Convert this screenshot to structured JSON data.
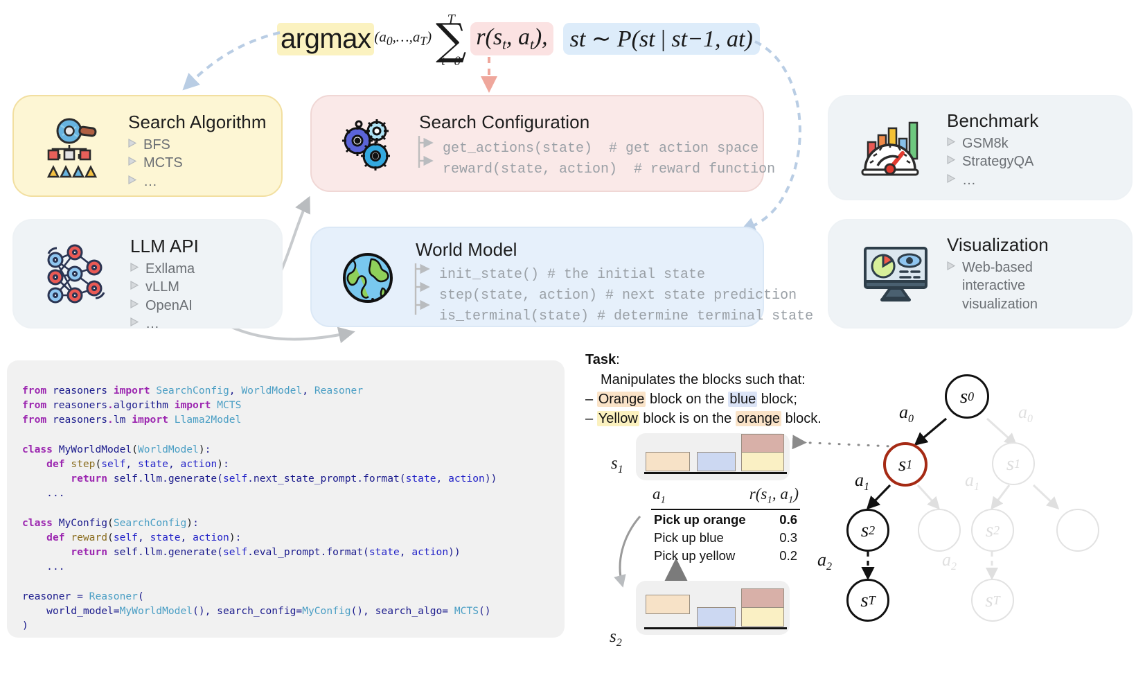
{
  "equation": {
    "argmax": "argmax",
    "argmax_sub": "(a₀,…,a_T)",
    "sigma_top": "T",
    "sigma_bottom": "t=0",
    "reward_term": "r(s_t, a_t),",
    "transition_term": "s_t ~ P(s_t | s_{t-1}, a_t)"
  },
  "modules": {
    "search_algorithm": {
      "title": "Search Algorithm",
      "icon": "magnifier-tree-icon",
      "items": [
        "BFS",
        "MCTS",
        "…"
      ]
    },
    "search_configuration": {
      "title": "Search Configuration",
      "icon": "gears-icon",
      "methods": [
        "get_actions(state)  # get action space",
        "reward(state, action)  # reward function"
      ]
    },
    "benchmark": {
      "title": "Benchmark",
      "icon": "gauge-chart-icon",
      "items": [
        "GSM8k",
        "StrategyQA",
        "…"
      ]
    },
    "llm_api": {
      "title": "LLM API",
      "icon": "neural-network-icon",
      "items": [
        "Exllama",
        "vLLM",
        "OpenAI",
        "…"
      ]
    },
    "world_model": {
      "title": "World Model",
      "icon": "globe-icon",
      "methods": [
        "init_state() # the initial state",
        "step(state, action) # next state prediction",
        "is_terminal(state) # determine terminal state"
      ]
    },
    "visualization": {
      "title": "Visualization",
      "icon": "monitor-chart-icon",
      "items": [
        "Web-based interactive visualization"
      ]
    }
  },
  "code": {
    "lines": [
      "from reasoners import SearchConfig, WorldModel, Reasoner",
      "from reasoners.algorithm import MCTS",
      "from reasoners.lm import Llama2Model",
      "",
      "class MyWorldModel(WorldModel):",
      "    def step(self, state, action):",
      "        return self.llm.generate(self.next_state_prompt.format(state, action))",
      "    ...",
      "",
      "class MyConfig(SearchConfig):",
      "    def reward(self, state, action):",
      "        return self.llm.generate(self.eval_prompt.format(state, action))",
      "    ...",
      "",
      "reasoner = Reasoner(",
      "    world_model=MyWorldModel(), search_config=MyConfig(), search_algo= MCTS()",
      ")"
    ]
  },
  "task": {
    "heading": "Task",
    "heading_colon": ":",
    "line1": "Manipulates the blocks such that:",
    "bullet1_dash": "–",
    "bullet1_a": "Orange",
    "bullet1_b": " block on the ",
    "bullet1_c": "blue",
    "bullet1_d": " block;",
    "bullet2_dash": "–",
    "bullet2_a": "Yellow",
    "bullet2_b": " block is on the ",
    "bullet2_c": "orange",
    "bullet2_d": " block."
  },
  "states": {
    "s1_label": "s",
    "s1_sub": "1",
    "s2_label": "s",
    "s2_sub": "2"
  },
  "reward_table": {
    "col_action": "a",
    "col_action_sub": "1",
    "col_reward": "r(s",
    "col_reward_sub1": "1",
    "col_reward_mid": ", a",
    "col_reward_sub2": "1",
    "col_reward_end": ")",
    "rows": [
      {
        "action": "Pick up orange",
        "reward": "0.6",
        "selected": true
      },
      {
        "action": "Pick up blue",
        "reward": "0.3",
        "selected": false
      },
      {
        "action": "Pick up yellow",
        "reward": "0.2",
        "selected": false
      }
    ]
  },
  "tree": {
    "nodes": [
      {
        "id": "s0",
        "label": "s",
        "sub": "0",
        "style": "black"
      },
      {
        "id": "s1",
        "label": "s",
        "sub": "1",
        "style": "red"
      },
      {
        "id": "s2",
        "label": "s",
        "sub": "2",
        "style": "black"
      },
      {
        "id": "sT",
        "label": "s",
        "sub": "T",
        "style": "black"
      },
      {
        "id": "g_s1",
        "label": "s",
        "sub": "1",
        "style": "ghost"
      },
      {
        "id": "g_empty1",
        "label": "",
        "sub": "",
        "style": "ghost"
      },
      {
        "id": "g_s2",
        "label": "s",
        "sub": "2",
        "style": "ghost"
      },
      {
        "id": "g_empty2",
        "label": "",
        "sub": "",
        "style": "ghost"
      },
      {
        "id": "g_sT",
        "label": "s",
        "sub": "T",
        "style": "ghost"
      }
    ],
    "edges": [
      {
        "label": "a",
        "sub": "0",
        "style": "solid"
      },
      {
        "label": "a",
        "sub": "1",
        "style": "solid"
      },
      {
        "label": "a",
        "sub": "2",
        "style": "dashed"
      },
      {
        "label": "a",
        "sub": "0",
        "style": "ghost"
      },
      {
        "label": "a",
        "sub": "1",
        "style": "ghost"
      },
      {
        "label": "a",
        "sub": "2",
        "style": "ghost-dashed"
      }
    ]
  },
  "colors": {
    "yellow_card": "#fdf6d4",
    "pink_card": "#fae9e8",
    "blue_card": "#e6f0fb",
    "grey_card": "#eff3f6",
    "accent_red": "#a52a14",
    "code_keyword": "#9c27b0",
    "code_arg": "#2323c8",
    "code_class": "#4a9ec4"
  }
}
